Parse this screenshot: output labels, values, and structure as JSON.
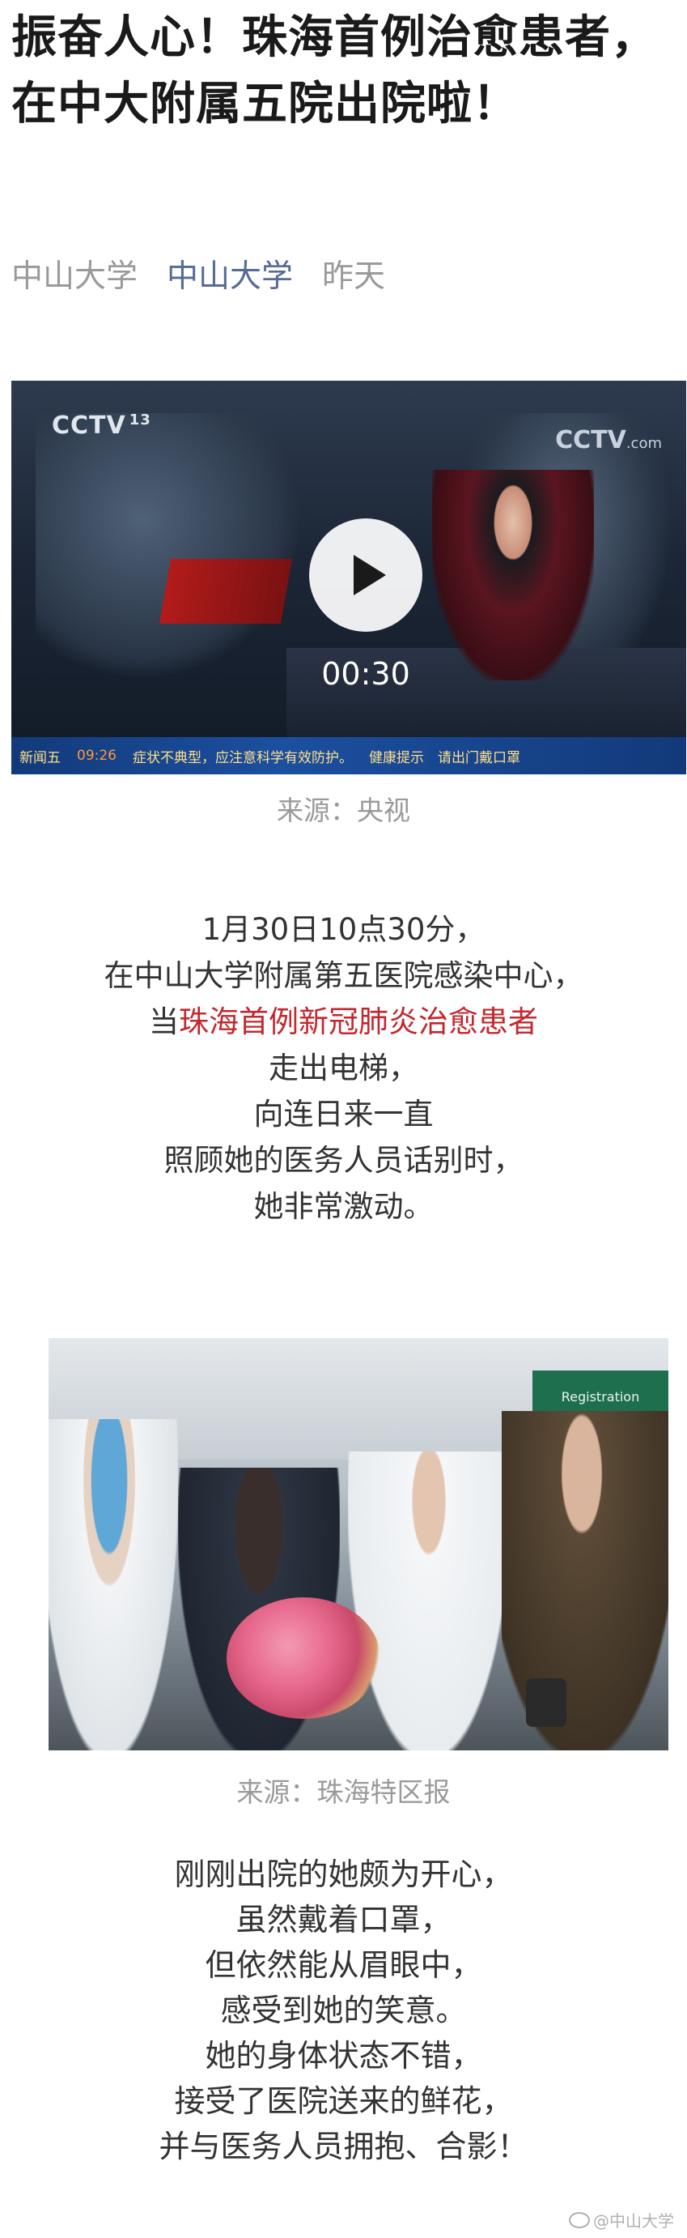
{
  "article": {
    "title": "振奋人心！珠海首例治愈患者，在中大附属五院出院啦！",
    "author": "中山大学",
    "account": "中山大学",
    "date": "昨天"
  },
  "video": {
    "duration": "00:30",
    "logo_left": "CCTV",
    "logo_left_channel": "13",
    "logo_right": "CCTV",
    "logo_right_domain": ".com",
    "ticker_station": "新闻五",
    "ticker_time": "09:26",
    "ticker_text": "症状不典型，应注意科学有效防护。",
    "ticker_tip": "健康提示　请出门戴口罩"
  },
  "caption_video": "来源：央视",
  "paragraph1": {
    "line1": "1月30日10点30分，",
    "line2": "在中山大学附属第五医院感染中心，",
    "line3_prefix": "当",
    "line3_highlight": "珠海首例新冠肺炎治愈患者",
    "line4": "走出电梯，",
    "line5": "向连日来一直",
    "line6": "照顾她的医务人员话别时，",
    "line7": "她非常激动。"
  },
  "photo": {
    "sign_text": "Registration"
  },
  "caption_photo": "来源：珠海特区报",
  "paragraph2": {
    "line1": "刚刚出院的她颇为开心，",
    "line2": "虽然戴着口罩，",
    "line3": "但依然能从眉眼中，",
    "line4": "感受到她的笑意。",
    "line5": "她的身体状态不错，",
    "line6": "接受了医院送来的鲜花，",
    "line7": "并与医务人员拥抱、合影！"
  },
  "watermark": "@中山大学",
  "colors": {
    "account_link": "#576b95",
    "highlight_red": "#c2282e",
    "meta_gray": "#9a9a9a",
    "body_text": "#333333"
  }
}
